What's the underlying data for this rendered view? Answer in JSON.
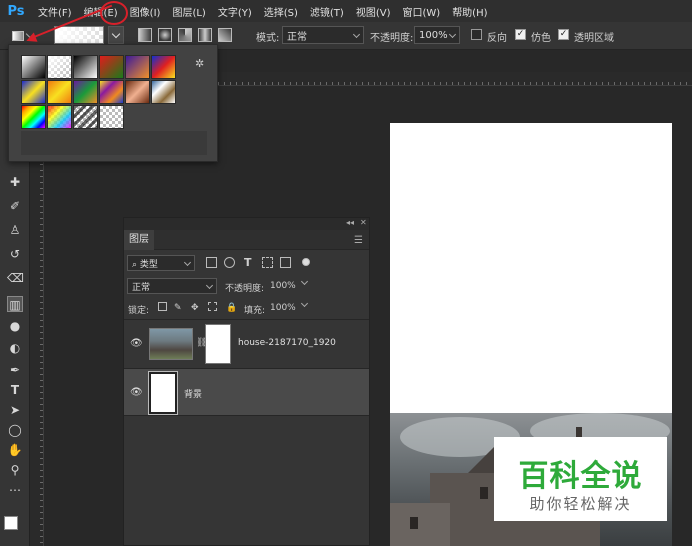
{
  "app": {
    "logo": "Ps",
    "logo_color": "#31a8ff"
  },
  "menu": [
    "文件(F)",
    "编辑(E)",
    "图像(I)",
    "图层(L)",
    "文字(Y)",
    "选择(S)",
    "滤镜(T)",
    "视图(V)",
    "窗口(W)",
    "帮助(H)"
  ],
  "options": {
    "mode_label": "模式:",
    "mode_value": "正常",
    "opacity_label": "不透明度:",
    "opacity_value": "100%",
    "reverse_label": "反向",
    "reverse_checked": false,
    "dither_label": "仿色",
    "dither_checked": true,
    "transparency_label": "透明区域",
    "transparency_checked": true,
    "check_mark": "✓"
  },
  "gradient_popup": {
    "gear": "✲",
    "presets": [
      "fg-bg",
      "fg-transparent",
      "black-white",
      "red-green",
      "violet-orange",
      "blue-red-yellow",
      "blue-yellow-blue",
      "orange-yellow-orange",
      "violet-green-orange",
      "yellow-violet-orange-blue",
      "copper",
      "chrome",
      "spectrum",
      "transparent-rainbow",
      "transparent-stripes",
      "transparent-checker"
    ]
  },
  "layers_panel": {
    "tab": "图层",
    "collapse": "◂◂",
    "close": "✕",
    "menu": "☰",
    "filter_kind": "⌕ 类型",
    "blend_mode": "正常",
    "opacity_label": "不透明度:",
    "opacity_value": "100%",
    "lock_label": "锁定:",
    "fill_label": "填充:",
    "fill_value": "100%",
    "layers": [
      {
        "name": "house-2187170_1920",
        "type": "smart",
        "selected": false
      },
      {
        "name": "背景",
        "type": "background",
        "selected": true
      }
    ],
    "eye": "👁",
    "link": "⛓"
  },
  "watermark": {
    "title": "百科全说",
    "subtitle": "助你轻松解决",
    "title_color": "#2eaa3a"
  },
  "colors": {
    "foreground": "#ffffff",
    "background": "#6a4fd8",
    "annotation": "#d8202a"
  }
}
